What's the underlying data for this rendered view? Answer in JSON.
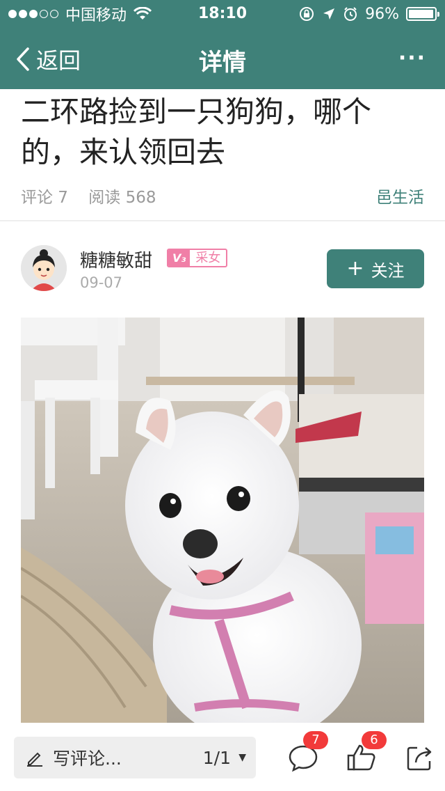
{
  "status_bar": {
    "carrier": "中国移动",
    "time": "18:10",
    "battery": "96%",
    "battery_level": 0.96,
    "signal_bars_filled": 3,
    "signal_bars_total": 5
  },
  "nav": {
    "back_label": "返回",
    "title": "详情",
    "more_label": "···"
  },
  "article": {
    "title": "二环路捡到一只狗狗，哪个的，来认领回去",
    "comments_label": "评论 7",
    "reads_label": "阅读 568",
    "category": "邑生活"
  },
  "author": {
    "name": "糖糖敏甜",
    "badge_level": "V₃",
    "badge_title": "采女",
    "date": "09-07",
    "follow_label": "关注"
  },
  "bottom_bar": {
    "write_placeholder": "写评论...",
    "page_indicator": "1/1",
    "comment_count": "7",
    "like_count": "6"
  },
  "colors": {
    "accent": "#3f8179",
    "badge_pink": "#f07fa7",
    "count_red": "#f23a3a"
  },
  "icons": {
    "back": "chevron-left-icon",
    "more": "more-dots-icon",
    "wifi": "wifi-icon",
    "rotation_lock": "rotation-lock-icon",
    "location": "location-arrow-icon",
    "alarm": "alarm-icon",
    "pencil": "pencil-icon",
    "comment": "comment-bubble-icon",
    "like": "thumbs-up-icon",
    "share": "share-icon"
  }
}
